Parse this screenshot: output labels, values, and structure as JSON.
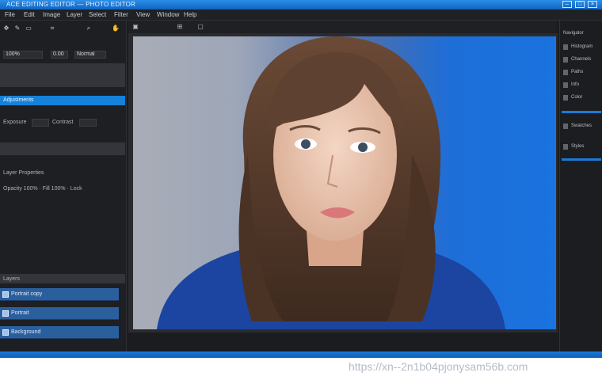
{
  "window": {
    "title": "ACE EDITING EDITOR — PHOTO EDITOR",
    "controls": [
      "–",
      "□",
      "×"
    ]
  },
  "menu": {
    "items": [
      "File",
      "Edit",
      "Image",
      "Layer",
      "Select",
      "Filter",
      "View",
      "Window",
      "Help"
    ]
  },
  "left_panel": {
    "tools": [
      "move-icon",
      "brush-icon",
      "eraser-icon",
      "crop-icon",
      "zoom-icon",
      "hand-icon"
    ],
    "fields": [
      "100%",
      "0.00",
      "Normal"
    ],
    "section_title": "Adjustments",
    "sub_labels": [
      "Exposure",
      "Contrast",
      "Layer Properties",
      "Opacity 100% · Fill 100% · Lock"
    ],
    "layers": [
      "Layers",
      "Portrait copy",
      "Portrait",
      "Background"
    ]
  },
  "right_panel": {
    "labels": [
      "Navigator",
      "Histogram",
      "Channels",
      "Paths",
      "Info",
      "Color",
      "Swatches",
      "Styles"
    ]
  },
  "watermark": "https://xn--2n1b04pjonysam56b.com",
  "colors": {
    "accent": "#1581d9",
    "panel": "#1e1f22",
    "titlebar": "#1472d0"
  }
}
